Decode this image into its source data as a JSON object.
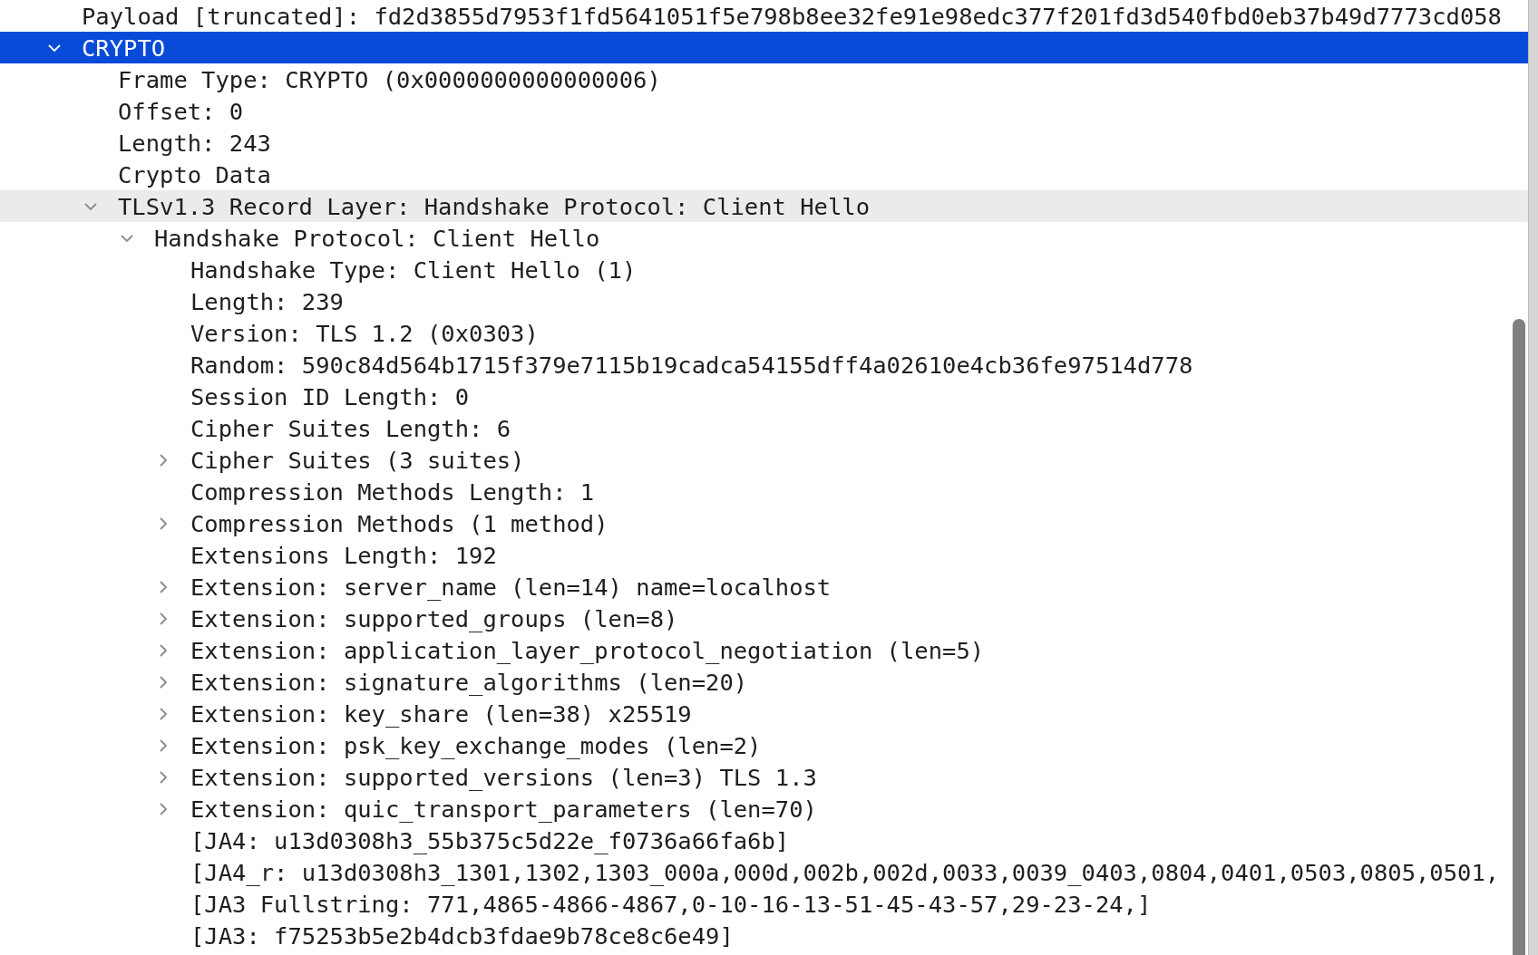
{
  "tree": [
    {
      "label": "Payload [truncated]: fd2d3855d7953f1fd5641051f5e798b8ee32fe91e98edc377f201fd3d540fbd0eb37b49d7773cd058",
      "selected": false,
      "hovered": false
    },
    {
      "label": "CRYPTO",
      "expanded": true,
      "selected": true,
      "hovered": false,
      "children": [
        {
          "label": "Frame Type: CRYPTO (0x0000000000000006)",
          "selected": false,
          "hovered": false
        },
        {
          "label": "Offset: 0",
          "selected": false,
          "hovered": false
        },
        {
          "label": "Length: 243",
          "selected": false,
          "hovered": false
        },
        {
          "label": "Crypto Data",
          "selected": false,
          "hovered": false
        },
        {
          "label": "TLSv1.3 Record Layer: Handshake Protocol: Client Hello",
          "expanded": true,
          "selected": false,
          "hovered": true,
          "children": [
            {
              "label": "Handshake Protocol: Client Hello",
              "expanded": true,
              "selected": false,
              "hovered": false,
              "children": [
                {
                  "label": "Handshake Type: Client Hello (1)",
                  "selected": false,
                  "hovered": false
                },
                {
                  "label": "Length: 239",
                  "selected": false,
                  "hovered": false
                },
                {
                  "label": "Version: TLS 1.2 (0x0303)",
                  "selected": false,
                  "hovered": false
                },
                {
                  "label": "Random: 590c84d564b1715f379e7115b19cadca54155dff4a02610e4cb36fe97514d778",
                  "selected": false,
                  "hovered": false
                },
                {
                  "label": "Session ID Length: 0",
                  "selected": false,
                  "hovered": false
                },
                {
                  "label": "Cipher Suites Length: 6",
                  "selected": false,
                  "hovered": false
                },
                {
                  "label": "Cipher Suites (3 suites)",
                  "expanded": false,
                  "selected": false,
                  "hovered": false
                },
                {
                  "label": "Compression Methods Length: 1",
                  "selected": false,
                  "hovered": false
                },
                {
                  "label": "Compression Methods (1 method)",
                  "expanded": false,
                  "selected": false,
                  "hovered": false
                },
                {
                  "label": "Extensions Length: 192",
                  "selected": false,
                  "hovered": false
                },
                {
                  "label": "Extension: server_name (len=14) name=localhost",
                  "expanded": false,
                  "selected": false,
                  "hovered": false
                },
                {
                  "label": "Extension: supported_groups (len=8)",
                  "expanded": false,
                  "selected": false,
                  "hovered": false
                },
                {
                  "label": "Extension: application_layer_protocol_negotiation (len=5)",
                  "expanded": false,
                  "selected": false,
                  "hovered": false
                },
                {
                  "label": "Extension: signature_algorithms (len=20)",
                  "expanded": false,
                  "selected": false,
                  "hovered": false
                },
                {
                  "label": "Extension: key_share (len=38) x25519",
                  "expanded": false,
                  "selected": false,
                  "hovered": false
                },
                {
                  "label": "Extension: psk_key_exchange_modes (len=2)",
                  "expanded": false,
                  "selected": false,
                  "hovered": false
                },
                {
                  "label": "Extension: supported_versions (len=3) TLS 1.3",
                  "expanded": false,
                  "selected": false,
                  "hovered": false
                },
                {
                  "label": "Extension: quic_transport_parameters (len=70)",
                  "expanded": false,
                  "selected": false,
                  "hovered": false
                },
                {
                  "label": "[JA4: u13d0308h3_55b375c5d22e_f0736a66fa6b]",
                  "selected": false,
                  "hovered": false
                },
                {
                  "label": "[JA4_r: u13d0308h3_1301,1302,1303_000a,000d,002b,002d,0033,0039_0403,0804,0401,0503,0805,0501,",
                  "selected": false,
                  "hovered": false
                },
                {
                  "label": "[JA3 Fullstring: 771,4865-4866-4867,0-10-16-13-51-45-43-57,29-23-24,]",
                  "selected": false,
                  "hovered": false
                },
                {
                  "label": "[JA3: f75253b5e2b4dcb3fdae9b78ce8c6e49]",
                  "selected": false,
                  "hovered": false
                }
              ]
            }
          ]
        }
      ]
    }
  ]
}
